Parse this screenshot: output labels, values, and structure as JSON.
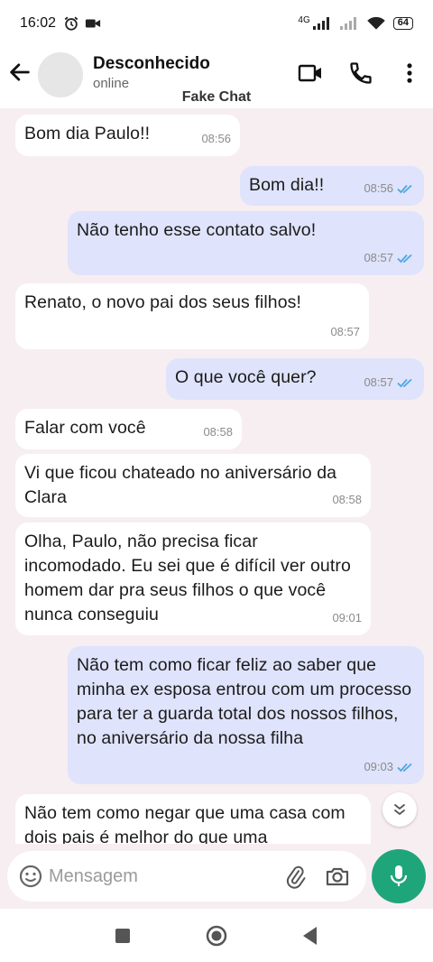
{
  "status_bar": {
    "time": "16:02",
    "network": "4G",
    "battery": "64"
  },
  "header": {
    "contact_name": "Desconhecido",
    "contact_status": "online",
    "app_label": "Fake Chat"
  },
  "messages": [
    {
      "side": "in",
      "text": "Bom dia Paulo!!",
      "time": "08:56"
    },
    {
      "side": "out",
      "text": "Bom dia!!",
      "time": "08:56",
      "read": true
    },
    {
      "side": "out",
      "text": "Não tenho esse contato salvo!",
      "time": "08:57",
      "read": true
    },
    {
      "side": "in",
      "text": "Renato, o novo pai dos seus filhos!",
      "time": "08:57"
    },
    {
      "side": "out",
      "text": "O que você quer?",
      "time": "08:57",
      "read": true
    },
    {
      "side": "in",
      "text": "Falar com você",
      "time": "08:58"
    },
    {
      "side": "in",
      "text": "Vi que ficou chateado no aniversário da Clara",
      "time": "08:58"
    },
    {
      "side": "in",
      "text": "Olha, Paulo, não precisa ficar incomodado. Eu sei que é difícil ver outro homem dar pra seus filhos o que você nunca conseguiu",
      "time": "09:01"
    },
    {
      "side": "out",
      "text": "Não tem como ficar feliz ao saber que minha ex esposa entrou com um processo para ter a guarda total dos nossos filhos, no aniversário da nossa filha",
      "time": "09:03",
      "read": true
    },
    {
      "side": "in",
      "text": "Não tem como negar que uma casa com dois pais é melhor do que uma",
      "time": ""
    }
  ],
  "composer": {
    "placeholder": "Mensagem"
  },
  "colors": {
    "incoming": "#ffffff",
    "outgoing": "#dfe3fb",
    "accent": "#1fa57a",
    "read_tick": "#4fa8e0"
  },
  "icons": [
    "back-arrow-icon",
    "video-call-icon",
    "phone-icon",
    "more-vert-icon",
    "emoji-icon",
    "attach-icon",
    "camera-icon",
    "mic-icon",
    "scroll-down-icon"
  ]
}
